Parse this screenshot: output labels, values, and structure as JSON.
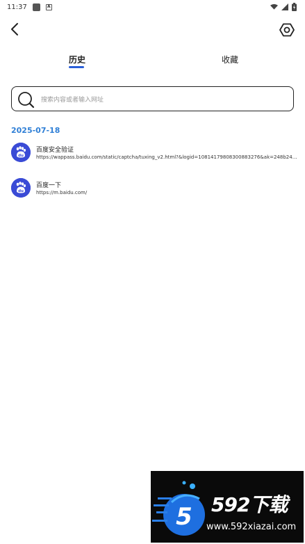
{
  "status_bar": {
    "time": "11:37",
    "app_icon": "square-icon",
    "notif_icon": "a-icon",
    "wifi_icon": "wifi-icon",
    "signal_icon": "signal-icon",
    "battery_icon": "battery-icon"
  },
  "toolbar": {
    "back_icon": "chevron-left-icon",
    "settings_icon": "hex-gear-icon"
  },
  "tabs": [
    {
      "label": "历史",
      "active": true
    },
    {
      "label": "收藏",
      "active": false
    }
  ],
  "search": {
    "placeholder": "搜索内容或者输入网址",
    "icon": "search-icon"
  },
  "history": {
    "date": "2025-07-18",
    "items": [
      {
        "title": "百度安全验证",
        "url": "https://wappass.baidu.com/static/captcha/tuxing_v2.html?&logid=10814179808300883276&ak=248b24c1...",
        "icon": "baidu-paw-icon"
      },
      {
        "title": "百度一下",
        "url": "https://m.baidu.com/",
        "icon": "baidu-paw-icon"
      }
    ]
  },
  "watermark": {
    "title": "592下载",
    "url": "www.592xiazai.com",
    "logo_text": "5"
  },
  "colors": {
    "accent": "#2a5fd8",
    "date": "#2f7fd6",
    "favicon": "#3a4bd6"
  }
}
